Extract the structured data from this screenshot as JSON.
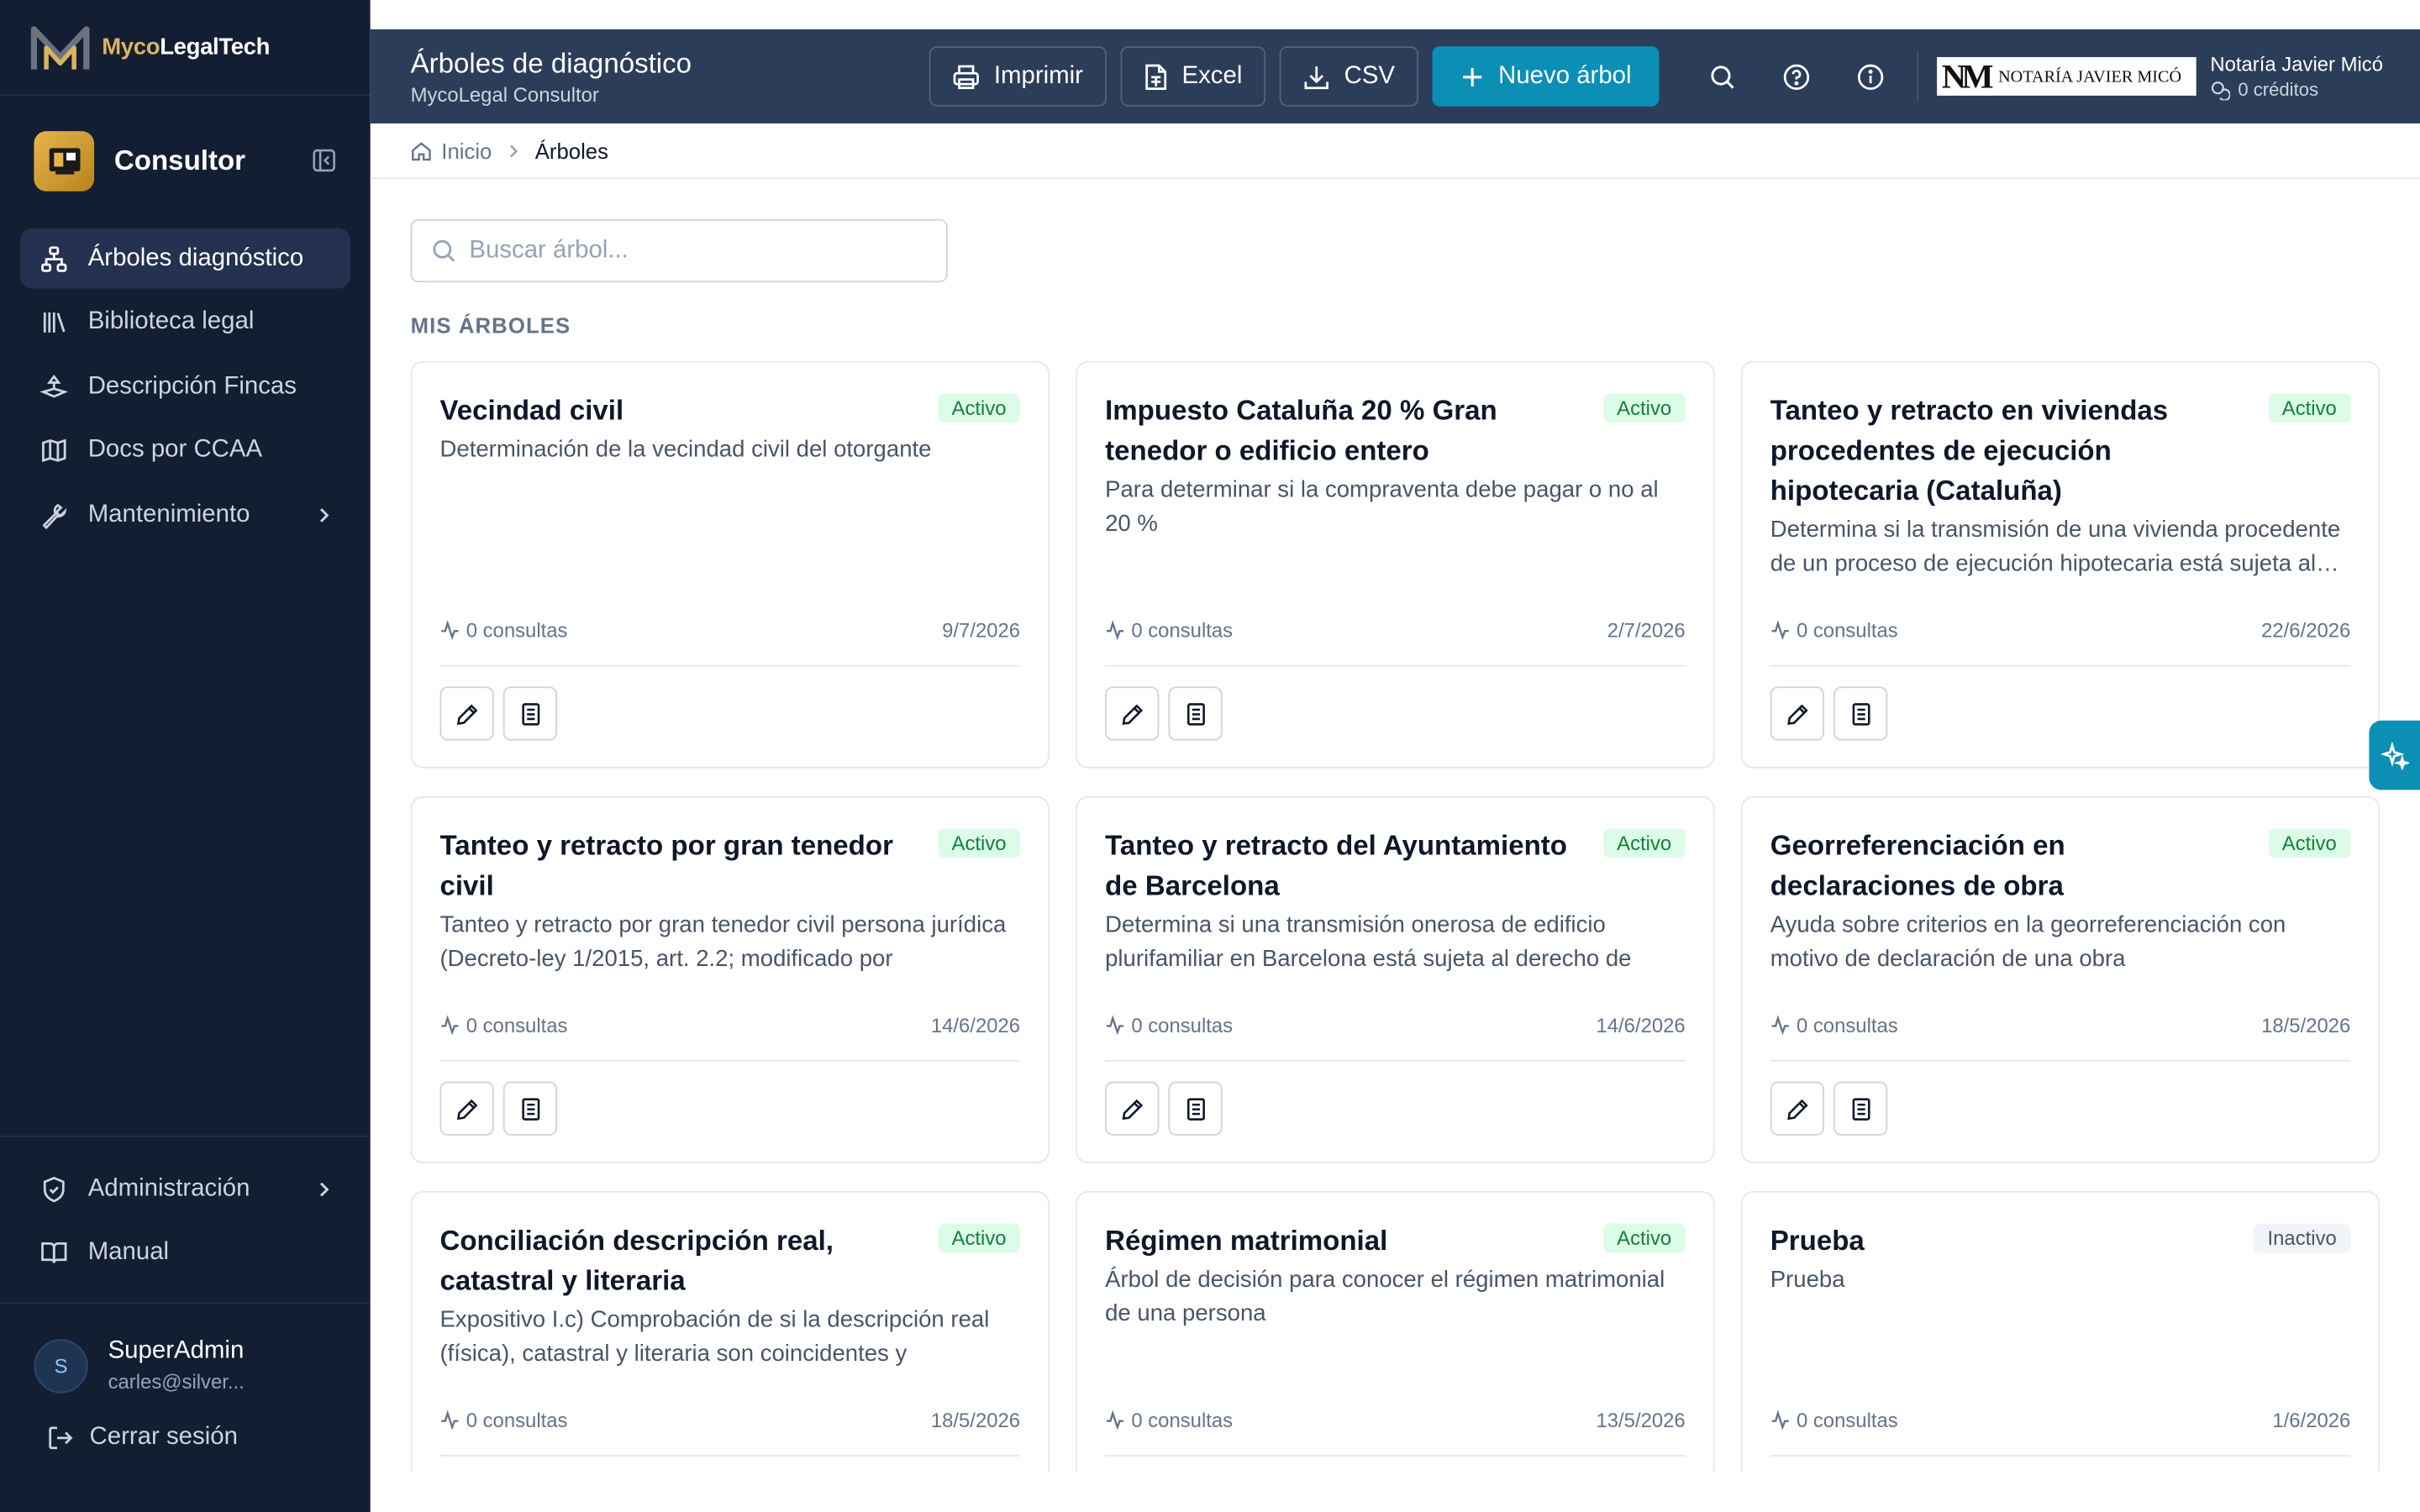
{
  "brand": {
    "name_part1": "Myco",
    "name_part2": "LegalTech"
  },
  "module": {
    "name": "Consultor"
  },
  "nav": [
    {
      "label": "Árboles diagnóstico",
      "icon": "tree-icon",
      "active": true
    },
    {
      "label": "Biblioteca legal",
      "icon": "library-icon"
    },
    {
      "label": "Descripción Fincas",
      "icon": "land-icon"
    },
    {
      "label": "Docs por CCAA",
      "icon": "map-icon"
    },
    {
      "label": "Mantenimiento",
      "icon": "wrench-icon",
      "has_children": true
    }
  ],
  "nav_bottom": [
    {
      "label": "Administración",
      "icon": "shield-icon",
      "has_children": true
    },
    {
      "label": "Manual",
      "icon": "book-icon"
    }
  ],
  "user": {
    "initial": "S",
    "name": "SuperAdmin",
    "email": "carles@silver..."
  },
  "logout_label": "Cerrar sesión",
  "header": {
    "title": "Árboles de diagnóstico",
    "subtitle": "MycoLegal Consultor",
    "print_label": "Imprimir",
    "excel_label": "Excel",
    "csv_label": "CSV",
    "new_label": "Nuevo árbol",
    "notaria_logo_monogram": "NM",
    "notaria_logo_text": "NOTARÍA JAVIER MICÓ",
    "notaria_name": "Notaría Javier Micó",
    "credits": "0 créditos"
  },
  "breadcrumb": {
    "home": "Inicio",
    "current": "Árboles"
  },
  "search": {
    "placeholder": "Buscar árbol..."
  },
  "section_title": "MIS ÁRBOLES",
  "cards": [
    {
      "title": "Vecindad civil",
      "status": "Activo",
      "desc": "Determinación de la vecindad civil del otorgante",
      "consultas": "0 consultas",
      "date": "9/7/2026"
    },
    {
      "title": "Impuesto Cataluña 20 % Gran tenedor o edificio entero",
      "status": "Activo",
      "desc": "Para determinar si la compraventa debe pagar o no al 20 %",
      "consultas": "0 consultas",
      "date": "2/7/2026"
    },
    {
      "title": "Tanteo y retracto en viviendas procedentes de ejecución hipotecaria (Cataluña)",
      "status": "Activo",
      "desc": "Determina si la transmisión de una vivienda procedente de un proceso de ejecución hipotecaria está sujeta al derecho de tanteo y retracto",
      "consultas": "0 consultas",
      "date": "22/6/2026"
    },
    {
      "title": "Tanteo y retracto por gran tenedor civil",
      "status": "Activo",
      "desc": "Tanteo y retracto por gran tenedor civil persona jurídica (Decreto-ley 1/2015, art. 2.2; modificado por",
      "consultas": "0 consultas",
      "date": "14/6/2026"
    },
    {
      "title": "Tanteo y retracto del Ayuntamiento de Barcelona",
      "status": "Activo",
      "desc": "Determina si una transmisión onerosa de edificio plurifamiliar en Barcelona está sujeta al derecho de",
      "consultas": "0 consultas",
      "date": "14/6/2026"
    },
    {
      "title": "Georreferenciación en declaraciones de obra",
      "status": "Activo",
      "desc": "Ayuda sobre criterios en la georreferenciación con motivo de declaración de una obra",
      "consultas": "0 consultas",
      "date": "18/5/2026"
    },
    {
      "title": "Conciliación descripción real, catastral y literaria",
      "status": "Activo",
      "desc": "Expositivo I.c) Comprobación de si la descripción real (física), catastral y literaria son coincidentes y",
      "consultas": "0 consultas",
      "date": "18/5/2026"
    },
    {
      "title": "Régimen matrimonial",
      "status": "Activo",
      "desc": "Árbol de decisión para conocer el régimen matrimonial de una persona",
      "consultas": "0 consultas",
      "date": "13/5/2026"
    },
    {
      "title": "Prueba",
      "status": "Inactivo",
      "desc": "Prueba",
      "consultas": "0 consultas",
      "date": "1/6/2026"
    }
  ]
}
